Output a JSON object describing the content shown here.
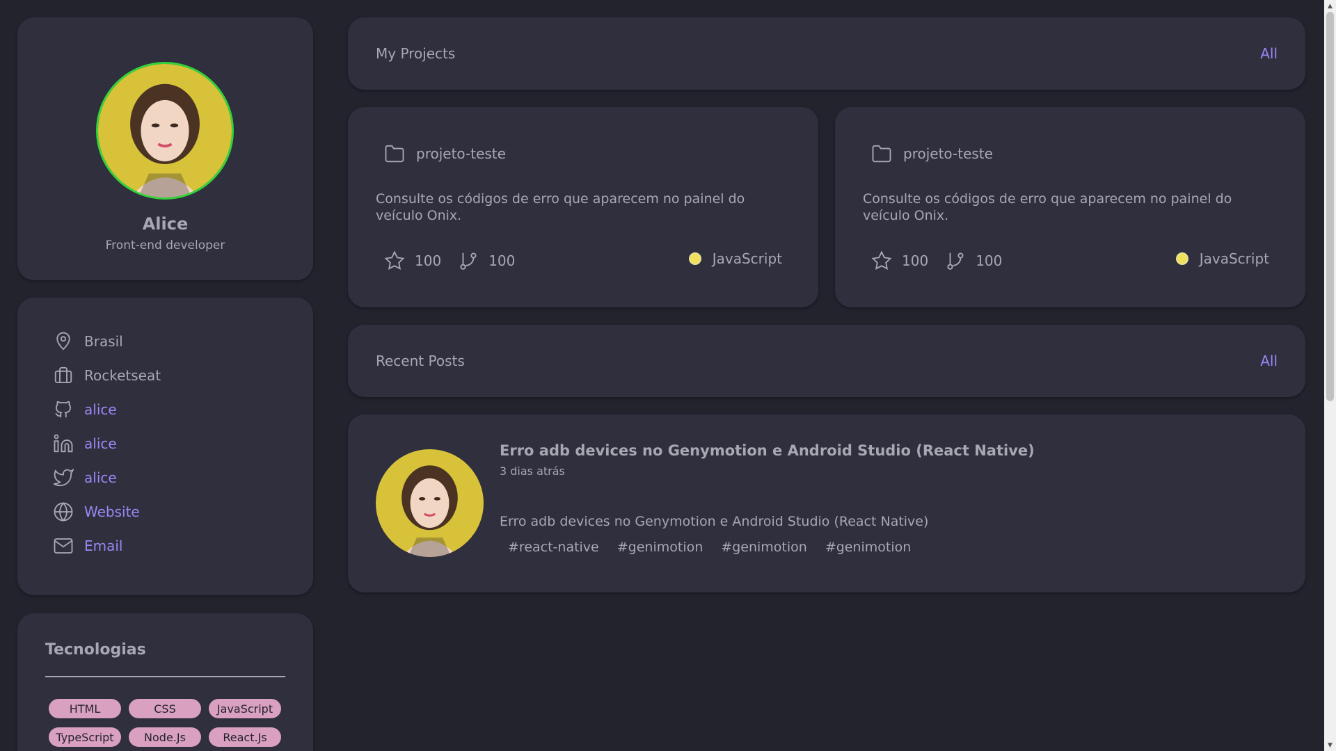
{
  "profile": {
    "name": "Alice",
    "role": "Front-end developer",
    "avatar_icon": "avatar-portrait"
  },
  "info": {
    "items": [
      {
        "icon": "map-pin-icon",
        "label": "Brasil",
        "link": false
      },
      {
        "icon": "briefcase-icon",
        "label": "Rocketseat",
        "link": false
      },
      {
        "icon": "github-icon",
        "label": "alice",
        "link": true
      },
      {
        "icon": "linkedin-icon",
        "label": "alice",
        "link": true
      },
      {
        "icon": "twitter-icon",
        "label": "alice",
        "link": true
      },
      {
        "icon": "globe-icon",
        "label": "Website",
        "link": true
      },
      {
        "icon": "mail-icon",
        "label": "Email",
        "link": true
      }
    ]
  },
  "tech": {
    "title": "Tecnologias",
    "tags": [
      "HTML",
      "CSS",
      "JavaScript",
      "TypeScript",
      "Node.Js",
      "React.Js"
    ]
  },
  "projects_bar": {
    "title": "My Projects",
    "link": "All"
  },
  "projects": [
    {
      "name": "projeto-teste",
      "description": "Consulte os códigos de erro que aparecem no painel do veículo Onix.",
      "stars": "100",
      "forks": "100",
      "language": "JavaScript",
      "language_color": "#f1e05a"
    },
    {
      "name": "projeto-teste",
      "description": "Consulte os códigos de erro que aparecem no painel do veículo Onix.",
      "stars": "100",
      "forks": "100",
      "language": "JavaScript",
      "language_color": "#f1e05a"
    }
  ],
  "posts_bar": {
    "title": "Recent Posts",
    "link": "All"
  },
  "post": {
    "title": "Erro adb devices no Genymotion e Android Studio (React Native)",
    "time": "3 dias atrás",
    "description": "Erro adb devices no Genymotion e Android Studio (React Native)",
    "tags": [
      "#react-native",
      "#genimotion",
      "#genimotion",
      "#genimotion"
    ]
  },
  "colors": {
    "background": "#23232e",
    "card": "#2f2f3e",
    "text": "#a8a8b3",
    "accent": "#9b87f5",
    "tag_bg": "#d9a0c0",
    "avatar_ring": "#32d43a"
  }
}
